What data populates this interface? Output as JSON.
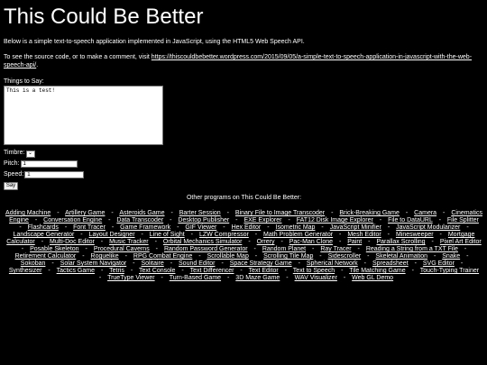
{
  "page": {
    "title": "This Could Be Better",
    "intro": "Below is a simple text-to-speech application implemented in JavaScript, using the HTML5 Web Speech API.",
    "source_prefix": "To see the source code, or to make a comment, visit ",
    "source_link": "https://thiscouldbebetter.wordpress.com/2015/09/05/a-simple-text-to-speech-application-in-javascript-with-the-web-speech-api/",
    "source_suffix": "."
  },
  "form": {
    "say_label": "Things to Say:",
    "say_value": "This is a test!",
    "timbre_label": "Timbre:",
    "timbre_value": "",
    "pitch_label": "Pitch:",
    "pitch_value": "1",
    "speed_label": "Speed:",
    "speed_value": "1",
    "say_button": "Say"
  },
  "others": {
    "title": "Other programs on This Could Be Better:",
    "separator": "-",
    "links": [
      "Adding Machine",
      "Artillery Game",
      "Asteroids Game",
      "Barter Session",
      "Binary File to Image Transcoder",
      "Brick-Breaking Game",
      "Camera",
      "Cinematics Engine",
      "Conversation Engine",
      "Data Transcoder",
      "Desktop Publisher",
      "EXE Explorer",
      "FAT12 Disk Image Explorer",
      "File to DataURL",
      "File Splitter",
      "Flashcards",
      "Font Tracer",
      "Game Framework",
      "GIF Viewer",
      "Hex Editor",
      "Isometric Map",
      "JavaScript Minifier",
      "JavaScript Modularizer",
      "Landscape Generator",
      "Layout Designer",
      "Line of Sight",
      "LZW Compressor",
      "Math Problem Generator",
      "Mesh Editor",
      "Minesweeper",
      "Mortgage Calculator",
      "Multi-Doc Editor",
      "Music Tracker",
      "Orbital Mechanics Simulator",
      "Orrery",
      "Pac-Man Clone",
      "Paint",
      "Parallax Scrolling",
      "Pixel Art Editor",
      "Posable Skeleton",
      "Procedural Caverns",
      "Random Password Generator",
      "Random Planet",
      "Ray Tracer",
      "Reading a String from a TXT File",
      "Retirement Calculator",
      "Roguelike",
      "RPG Combat Engine",
      "Scrollable Map",
      "Scrolling Tile Map",
      "Sidescroller",
      "Skeletal Animation",
      "Snake",
      "Sokoban",
      "Solar System Navigator",
      "Solitaire",
      "Sound Editor",
      "Space Strategy Game",
      "Spherical Network",
      "Spreadsheet",
      "SVG Editor",
      "Synthesizer",
      "Tactics Game",
      "Tetris",
      "Text Console",
      "Text Differencer",
      "Text Editor",
      "Text to Speech",
      "Tile Matching Game",
      "Touch-Typing Trainer",
      "TrueType Viewer",
      "Turn-Based Game",
      "3D Maze Game",
      "WAV Visualizer",
      "Web GL Demo"
    ]
  }
}
